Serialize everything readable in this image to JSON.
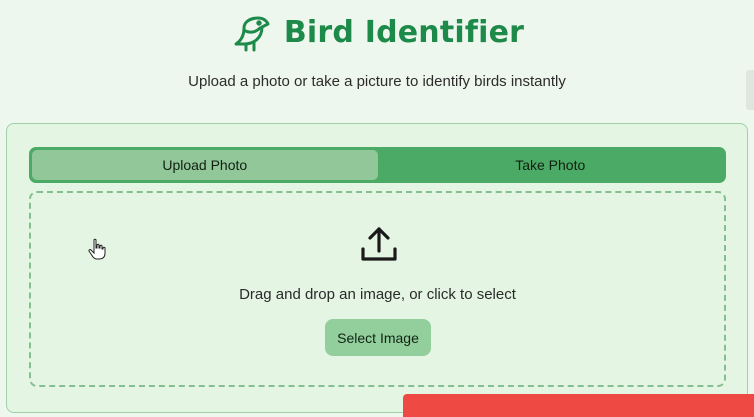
{
  "header": {
    "logo_icon": "bird-icon",
    "title": "Bird Identifier",
    "subtitle": "Upload a photo or take a picture to identify birds instantly"
  },
  "tabs": [
    {
      "label": "Upload Photo",
      "active": true
    },
    {
      "label": "Take Photo",
      "active": false
    }
  ],
  "dropzone": {
    "icon": "upload-icon",
    "text": "Drag and drop an image, or click to select",
    "button_label": "Select Image"
  },
  "colors": {
    "brand": "#1e8a4a",
    "tab_bar": "#4caa67",
    "tab_active": "#92c79a",
    "button": "#92cf9d",
    "card_bg": "#e4f6e3",
    "bottom_bar": "#ee4a43"
  }
}
